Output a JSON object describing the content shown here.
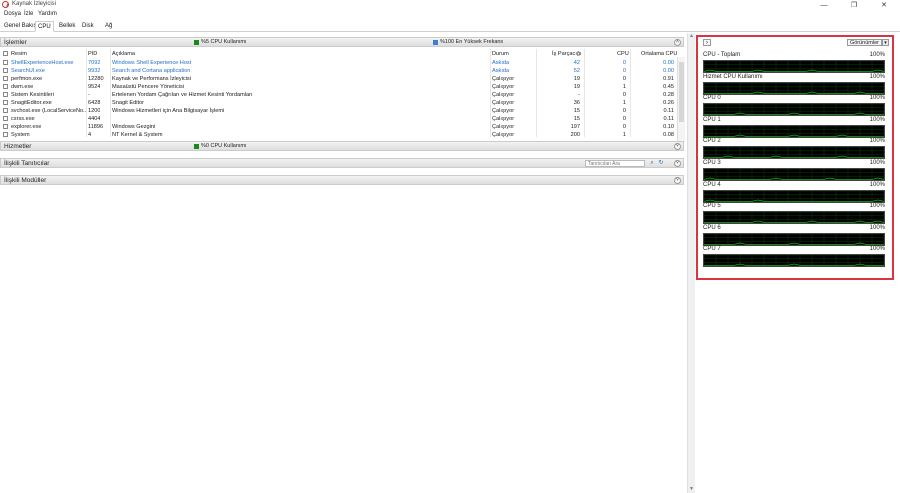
{
  "window": {
    "title": "Kaynak İzleyicisi",
    "minimize": "—",
    "maximize": "❐",
    "close": "✕"
  },
  "menu": [
    "Dosya",
    "İzle",
    "Yardım"
  ],
  "tabs": [
    "Genel Bakış",
    "CPU",
    "Bellek",
    "Disk",
    "Ağ"
  ],
  "active_tab": 1,
  "processes": {
    "title": "İşlemler",
    "cpu_meter": "%5 CPU Kullanımı",
    "freq_meter": "%100 En Yüksek Frekans",
    "columns": [
      "Resim",
      "PID",
      "Açıklama",
      "Durum",
      "İş Parçacığı",
      "CPU",
      "Ortalama CPU"
    ],
    "rows": [
      {
        "name": "ShellExperienceHost.exe",
        "pid": "7092",
        "desc": "Windows Shell Experience Host",
        "status": "Askıda",
        "threads": "42",
        "cpu": "0",
        "avg": "0.00",
        "suspended": true
      },
      {
        "name": "SearchUI.exe",
        "pid": "9932",
        "desc": "Search and Cortana application",
        "status": "Askıda",
        "threads": "52",
        "cpu": "0",
        "avg": "0.00",
        "suspended": true
      },
      {
        "name": "perfmon.exe",
        "pid": "12280",
        "desc": "Kaynak ve Performans İzleyicisi",
        "status": "Çalışıyor",
        "threads": "19",
        "cpu": "0",
        "avg": "0.91",
        "suspended": false
      },
      {
        "name": "dwm.exe",
        "pid": "9524",
        "desc": "Masaüstü Pencere Yöneticisi",
        "status": "Çalışıyor",
        "threads": "19",
        "cpu": "1",
        "avg": "0.45",
        "suspended": false
      },
      {
        "name": "Sistem Kesintileri",
        "pid": "-",
        "desc": "Ertelenen Yordam Çağrıları ve Hizmet Kesinti Yordamları",
        "status": "Çalışıyor",
        "threads": "-",
        "cpu": "0",
        "avg": "0.28",
        "suspended": false
      },
      {
        "name": "SnagitEditor.exe",
        "pid": "6428",
        "desc": "Snagit Editor",
        "status": "Çalışıyor",
        "threads": "36",
        "cpu": "1",
        "avg": "0.26",
        "suspended": false
      },
      {
        "name": "svchost.exe (LocalServiceNo...",
        "pid": "1200",
        "desc": "Windows Hizmetleri için Ana Bilgisayar İşlemi",
        "status": "Çalışıyor",
        "threads": "15",
        "cpu": "0",
        "avg": "0.11",
        "suspended": false
      },
      {
        "name": "csrss.exe",
        "pid": "4404",
        "desc": "",
        "status": "Çalışıyor",
        "threads": "15",
        "cpu": "0",
        "avg": "0.11",
        "suspended": false
      },
      {
        "name": "explorer.exe",
        "pid": "11896",
        "desc": "Windows Gezgini",
        "status": "Çalışıyor",
        "threads": "197",
        "cpu": "0",
        "avg": "0.10",
        "suspended": false
      },
      {
        "name": "System",
        "pid": "4",
        "desc": "NT Kernel & System",
        "status": "Çalışıyor",
        "threads": "200",
        "cpu": "1",
        "avg": "0.08",
        "suspended": false
      }
    ]
  },
  "services": {
    "title": "Hizmetler",
    "cpu_meter": "%0 CPU Kullanımı"
  },
  "handles": {
    "title": "İlişkili Tanıtıcılar",
    "search_placeholder": "Tanıtıcıları Ara"
  },
  "modules": {
    "title": "İlişkili Modüller"
  },
  "right_panel": {
    "views_label": "Görünümler",
    "graphs": [
      {
        "label": "CPU - Toplam",
        "pct": "100%",
        "zero": "0%",
        "color": "#1db21d"
      },
      {
        "label": "Hizmet CPU Kullanımı",
        "pct": "100%",
        "zero": "0%",
        "color": "#1db21d"
      },
      {
        "label": "CPU 0",
        "pct": "100%",
        "zero": "0%",
        "color": "#1db21d"
      },
      {
        "label": "CPU 1",
        "pct": "100%",
        "zero": "0%",
        "color": "#1db21d"
      },
      {
        "label": "CPU 2",
        "pct": "100%",
        "zero": "0%",
        "color": "#1db21d"
      },
      {
        "label": "CPU 3",
        "pct": "100%",
        "zero": "0%",
        "color": "#1db21d"
      },
      {
        "label": "CPU 4",
        "pct": "100%",
        "zero": "0%",
        "color": "#1db21d"
      },
      {
        "label": "CPU 5",
        "pct": "100%",
        "zero": "0%",
        "color": "#1db21d"
      },
      {
        "label": "CPU 6",
        "pct": "100%",
        "zero": "0%",
        "color": "#1db21d"
      },
      {
        "label": "CPU 7",
        "pct": "100%",
        "zero": "0%",
        "color": "#1db21d"
      }
    ]
  },
  "colors": {
    "meter_green": "#1a8a1a",
    "meter_blue": "#3b7ed6",
    "suspended_text": "#1f6fc7",
    "highlight_border": "#d9343f"
  }
}
